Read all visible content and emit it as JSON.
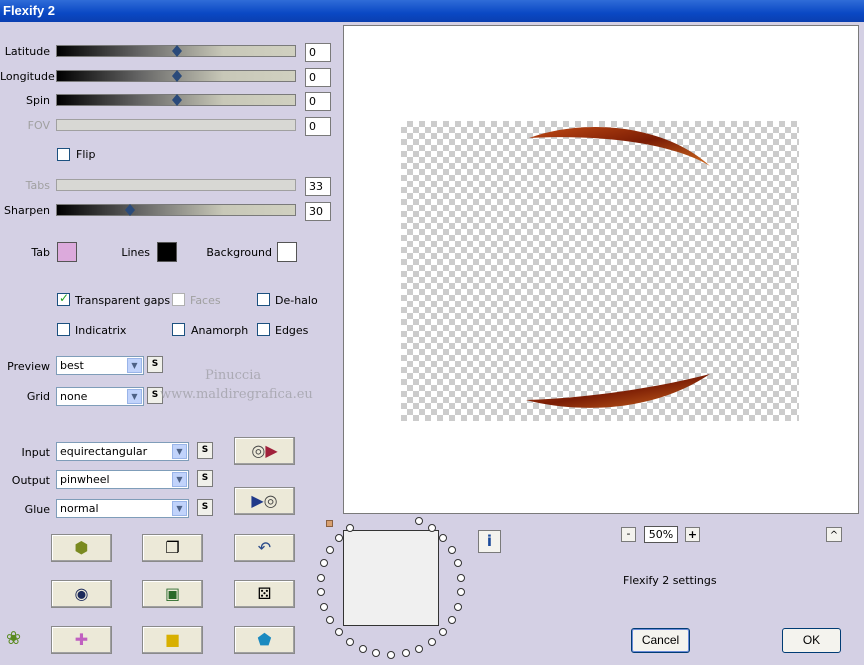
{
  "window": {
    "title": "Flexify 2"
  },
  "sliders": [
    {
      "label": "Latitude",
      "value": "0",
      "level": 0.5,
      "enabled": true
    },
    {
      "label": "Longitude",
      "value": "0",
      "level": 0.5,
      "enabled": true
    },
    {
      "label": "Spin",
      "value": "0",
      "level": 0.5,
      "enabled": true
    },
    {
      "label": "FOV",
      "value": "0",
      "level": 0.0,
      "enabled": false
    },
    {
      "label": "Tabs",
      "value": "33",
      "level": 0.0,
      "enabled": false
    },
    {
      "label": "Sharpen",
      "value": "30",
      "level": 0.3,
      "enabled": true
    }
  ],
  "flip": {
    "label": "Flip",
    "checked": false
  },
  "colors": {
    "tab": {
      "label": "Tab",
      "color": "#dcaadc"
    },
    "lines": {
      "label": "Lines",
      "color": "#000000"
    },
    "background": {
      "label": "Background",
      "color": "#ffffff"
    }
  },
  "options": {
    "transparent_gaps": {
      "label": "Transparent gaps",
      "checked": true
    },
    "faces": {
      "label": "Faces",
      "checked": false
    },
    "de_halo": {
      "label": "De-halo",
      "checked": false
    },
    "indicatrix": {
      "label": "Indicatrix",
      "checked": false
    },
    "anamorph": {
      "label": "Anamorph",
      "checked": false
    },
    "edges": {
      "label": "Edges",
      "checked": false
    }
  },
  "preview_select": {
    "label": "Preview",
    "value": "best"
  },
  "grid_select": {
    "label": "Grid",
    "value": "none"
  },
  "input_select": {
    "label": "Input",
    "value": "equirectangular"
  },
  "output_select": {
    "label": "Output",
    "value": "pinwheel"
  },
  "glue_select": {
    "label": "Glue",
    "value": "normal"
  },
  "s_label": "S",
  "watermark": {
    "line1": "Pinuccia",
    "line2": "www.maldiregrafica.eu"
  },
  "zoom": {
    "minus": "-",
    "value": "50%",
    "plus": "+"
  },
  "up_label": "^",
  "info_label": "i",
  "settings_text": "Flexify 2 settings",
  "buttons": {
    "cancel": "Cancel",
    "ok": "OK"
  }
}
